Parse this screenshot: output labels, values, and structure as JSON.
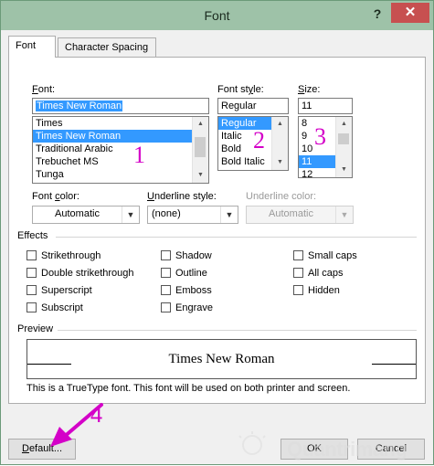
{
  "window": {
    "title": "Font",
    "help": "?",
    "close": "✕"
  },
  "tabs": [
    {
      "label": "Font",
      "active": true
    },
    {
      "label": "Character Spacing",
      "active": false
    }
  ],
  "font": {
    "label": "Font:",
    "value": "Times New Roman",
    "items": [
      "Times",
      "Times New Roman",
      "Traditional Arabic",
      "Trebuchet MS",
      "Tunga"
    ],
    "selected_index": 1
  },
  "font_style": {
    "label": "Font style:",
    "value": "Regular",
    "items": [
      "Regular",
      "Italic",
      "Bold",
      "Bold Italic"
    ],
    "selected_index": 0
  },
  "size": {
    "label": "Size:",
    "value": "11",
    "items": [
      "8",
      "9",
      "10",
      "11",
      "12"
    ],
    "selected_index": 3
  },
  "font_color": {
    "label": "Font color:",
    "value": "Automatic"
  },
  "underline_style": {
    "label": "Underline style:",
    "value": "(none)"
  },
  "underline_color": {
    "label": "Underline color:",
    "value": "Automatic"
  },
  "effects": {
    "label": "Effects",
    "items": [
      "Strikethrough",
      "Double strikethrough",
      "Superscript",
      "Subscript",
      "Shadow",
      "Outline",
      "Emboss",
      "Engrave",
      "Small caps",
      "All caps",
      "Hidden"
    ]
  },
  "preview": {
    "label": "Preview",
    "sample": "Times New Roman",
    "note": "This is a TrueType font. This font will be used on both printer and screen."
  },
  "buttons": {
    "default": "Default...",
    "ok": "OK",
    "cancel": "Cancel"
  },
  "annotations": {
    "n1": "1",
    "n2": "2",
    "n3": "3",
    "n4": "4"
  },
  "watermark": "Quantrimang",
  "colors": {
    "titlebar": "#9ec2a8",
    "selection": "#3399ff",
    "annotation": "#d400c8",
    "close": "#c75050"
  }
}
